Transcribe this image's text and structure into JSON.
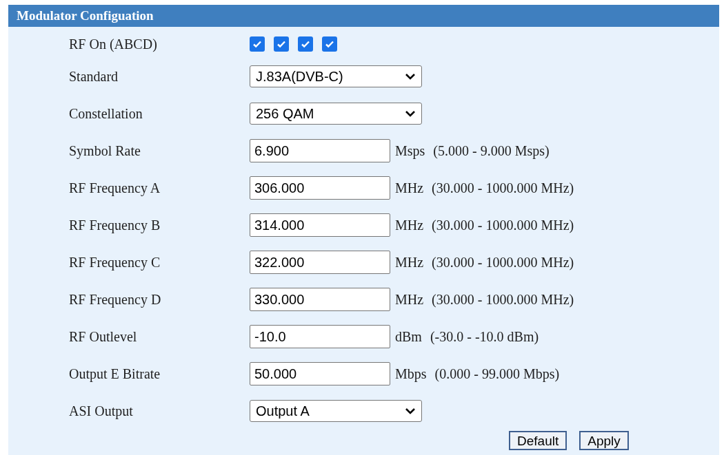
{
  "panel": {
    "title": "Modulator Configuation"
  },
  "rows": [
    {
      "kind": "checkboxes",
      "label": "RF On (ABCD)",
      "checkboxes": [
        {
          "checked": true
        },
        {
          "checked": true
        },
        {
          "checked": true
        },
        {
          "checked": true
        }
      ]
    },
    {
      "kind": "select",
      "label": "Standard",
      "value": "J.83A(DVB-C)"
    },
    {
      "kind": "select",
      "label": "Constellation",
      "value": "256 QAM"
    },
    {
      "kind": "input",
      "label": "Symbol Rate",
      "value": "6.900",
      "unit": "Msps",
      "range": "(5.000 - 9.000 Msps)"
    },
    {
      "kind": "input",
      "label": "RF Frequency A",
      "value": "306.000",
      "unit": "MHz",
      "range": "(30.000 - 1000.000 MHz)"
    },
    {
      "kind": "input",
      "label": "RF Frequency B",
      "value": "314.000",
      "unit": "MHz",
      "range": "(30.000 - 1000.000 MHz)"
    },
    {
      "kind": "input",
      "label": "RF Frequency C",
      "value": "322.000",
      "unit": "MHz",
      "range": "(30.000 - 1000.000 MHz)"
    },
    {
      "kind": "input",
      "label": "RF Frequency D",
      "value": "330.000",
      "unit": "MHz",
      "range": "(30.000 - 1000.000 MHz)"
    },
    {
      "kind": "input",
      "label": "RF Outlevel",
      "value": "-10.0",
      "unit": "dBm",
      "range": "(-30.0 - -10.0 dBm)"
    },
    {
      "kind": "input",
      "label": "Output E Bitrate",
      "value": "50.000",
      "unit": "Mbps",
      "range": "(0.000 - 99.000 Mbps)"
    },
    {
      "kind": "select",
      "label": "ASI Output",
      "value": "Output A"
    }
  ],
  "buttons": [
    "Default",
    "Apply"
  ]
}
